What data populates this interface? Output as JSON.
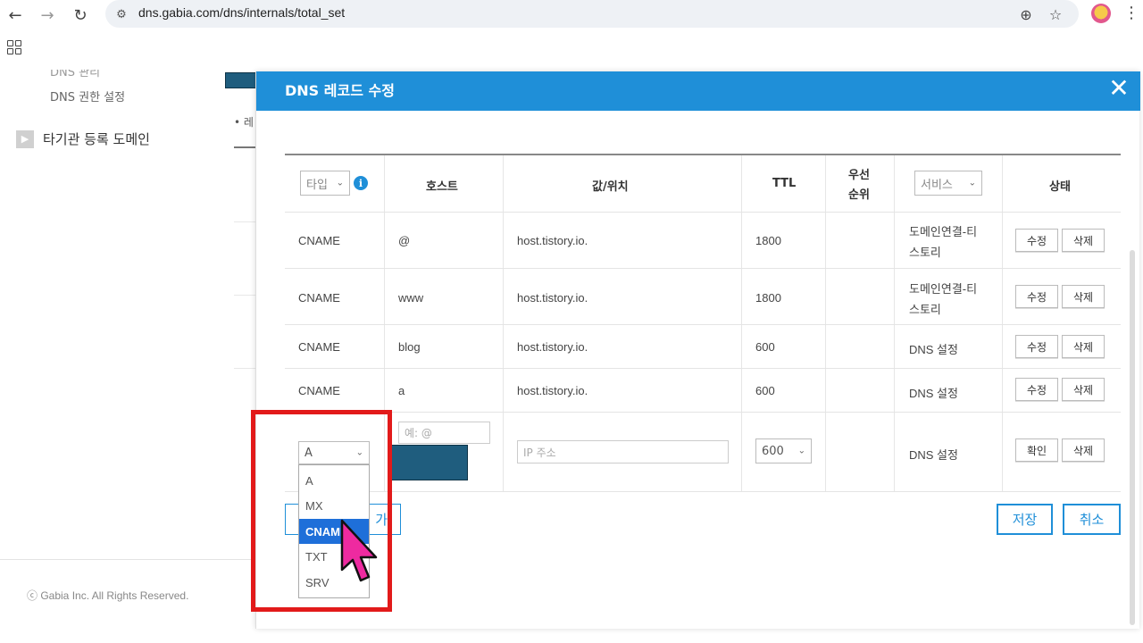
{
  "browser": {
    "url": "dns.gabia.com/dns/internals/total_set"
  },
  "sidebar": {
    "items": [
      {
        "label": "DNS 관리"
      },
      {
        "label": "DNS 권한 설정"
      },
      {
        "label": "타기관 등록 도메인"
      }
    ]
  },
  "background": {
    "tab_fragment": "• 레"
  },
  "footer": {
    "copyright": "ⓒ Gabia Inc. All Rights Reserved."
  },
  "modal": {
    "title": "DNS 레코드 수정",
    "table": {
      "type_filter": "타입",
      "headers": {
        "host": "호스트",
        "value": "값/위치",
        "ttl": "TTL",
        "priority_line1": "우선",
        "priority_line2": "순위",
        "service_filter": "서비스",
        "status": "상태"
      },
      "rows": [
        {
          "type": "CNAME",
          "host": "@",
          "value": "host.tistory.io.",
          "ttl": "1800",
          "service_line1": "도메인연결-티",
          "service_line2": "스토리",
          "edit": "수정",
          "delete": "삭제"
        },
        {
          "type": "CNAME",
          "host": "www",
          "value": "host.tistory.io.",
          "ttl": "1800",
          "service_line1": "도메인연결-티",
          "service_line2": "스토리",
          "edit": "수정",
          "delete": "삭제"
        },
        {
          "type": "CNAME",
          "host": "blog",
          "value": "host.tistory.io.",
          "ttl": "600",
          "service_line1": "DNS 설정",
          "service_line2": "",
          "edit": "수정",
          "delete": "삭제"
        },
        {
          "type": "CNAME",
          "host": "a",
          "value": "host.tistory.io.",
          "ttl": "600",
          "service_line1": "DNS 설정",
          "service_line2": "",
          "edit": "수정",
          "delete": "삭제"
        }
      ],
      "new_row": {
        "type_value": "A",
        "host_placeholder": "예: @",
        "value_placeholder": "IP 주소",
        "ttl_value": "600",
        "service": "DNS 설정",
        "confirm": "확인",
        "delete": "삭제"
      },
      "type_options": [
        "A",
        "MX",
        "CNAME",
        "TXT",
        "SRV"
      ],
      "selected_option": "CNAME"
    },
    "add_button": "가",
    "save_button": "저장",
    "cancel_button": "취소"
  },
  "colors": {
    "accent": "#1f8fd8",
    "highlight": "#e21a1a",
    "cursor": "#ee2aa0",
    "redaction": "#1f5d7e",
    "selected_option": "#1e6fd9"
  }
}
